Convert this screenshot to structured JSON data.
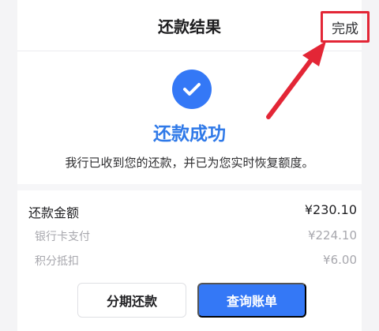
{
  "header": {
    "title": "还款结果",
    "done_label": "完成"
  },
  "result": {
    "icon": "check-icon",
    "title": "还款成功",
    "description": "我行已收到您的还款，并已为您实时恢复额度。"
  },
  "summary": {
    "total_label": "还款金额",
    "total_value": "¥230.10",
    "items": [
      {
        "label": "银行卡支付",
        "value": "¥224.10"
      },
      {
        "label": "积分抵扣",
        "value": "¥6.00"
      }
    ]
  },
  "actions": {
    "installment_label": "分期还款",
    "view_bill_label": "查询账单"
  },
  "colors": {
    "accent_blue": "#3478f6",
    "highlight_red": "#e32636"
  }
}
